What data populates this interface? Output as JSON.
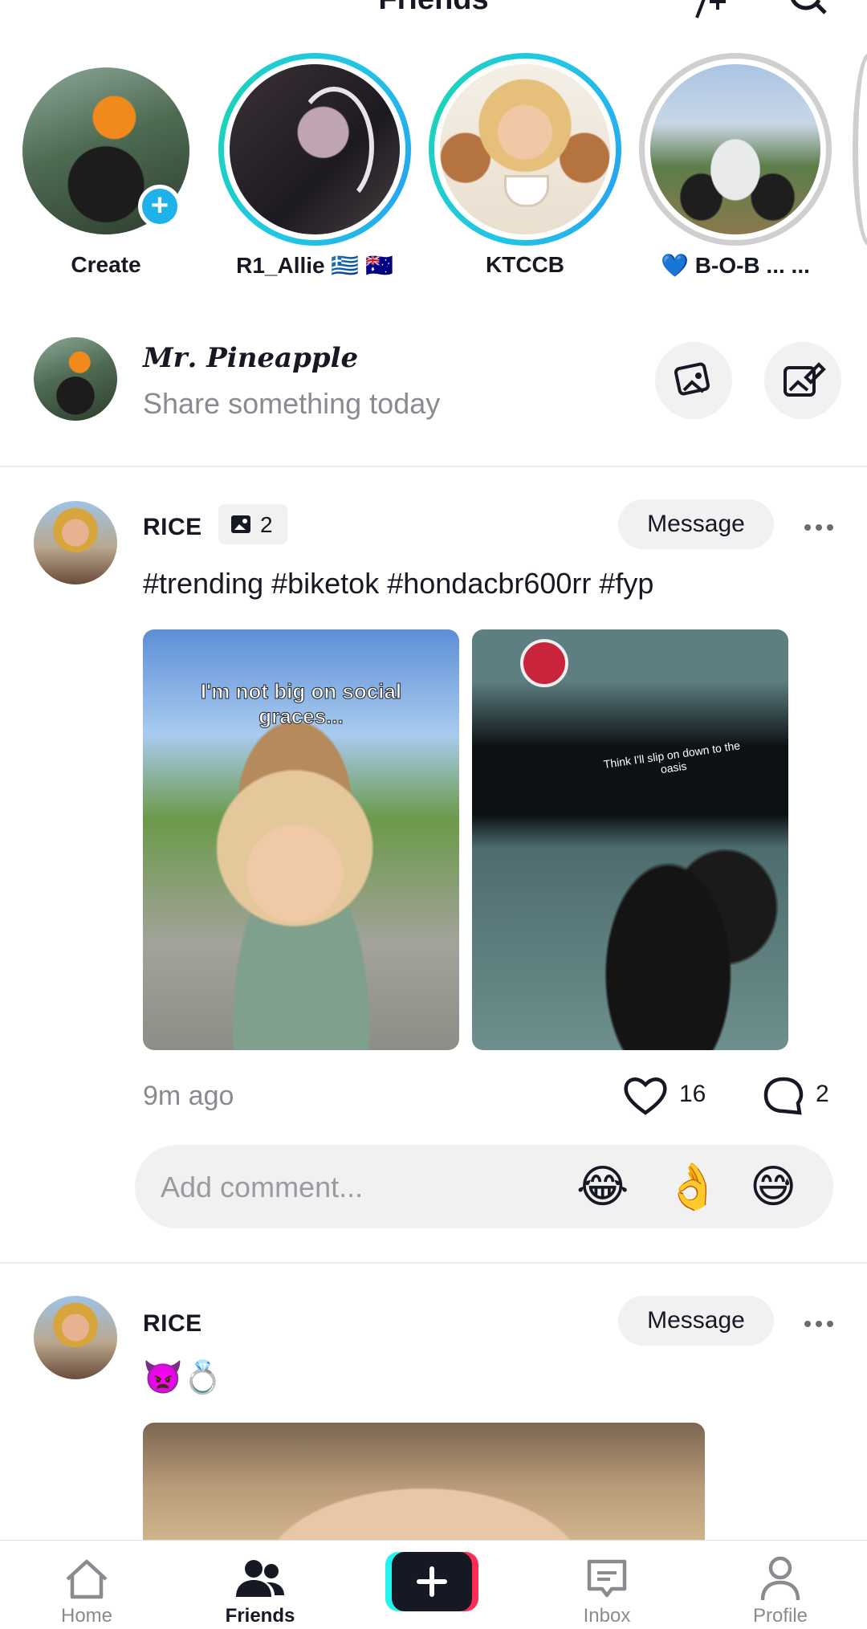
{
  "header": {
    "title": "Friends",
    "add_friend_icon": "person-plus-icon",
    "search_icon": "search-icon"
  },
  "stories": [
    {
      "label": "Create",
      "seen": false,
      "add": true
    },
    {
      "label": "R1_Allie 🇬🇷 🇦🇺",
      "seen": false
    },
    {
      "label": "KTCCB",
      "seen": false
    },
    {
      "label": "💙 B-O-B ... ...",
      "seen": true
    }
  ],
  "composer": {
    "name": "𝑴𝒓. 𝑷𝒊𝒏𝒆𝒂𝒑𝒑𝒍𝒆",
    "placeholder": "Share something today",
    "photo_icon": "photo-icon",
    "edit_icon": "edit-photo-icon"
  },
  "posts": [
    {
      "username": "RICE",
      "photo_count": "2",
      "message_label": "Message",
      "caption": "#trending #biketok #hondacbr600rr #fyp",
      "tiles": [
        {
          "overlay": "I'm not big on social graces..."
        },
        {
          "overlay": "Think I'll slip on down to the oasis"
        }
      ],
      "time": "9m ago",
      "likes": "16",
      "comments": "2",
      "comment_placeholder": "Add comment...",
      "quick_emojis": [
        "😂",
        "👌",
        "😅"
      ]
    },
    {
      "username": "RICE",
      "message_label": "Message",
      "caption": "👿💍"
    }
  ],
  "nav": {
    "items": [
      {
        "label": "Home",
        "icon": "home-icon",
        "active": false
      },
      {
        "label": "Friends",
        "icon": "friends-icon",
        "active": true
      },
      {
        "label": "",
        "icon": "plus-icon",
        "active": false
      },
      {
        "label": "Inbox",
        "icon": "inbox-icon",
        "active": false
      },
      {
        "label": "Profile",
        "icon": "profile-icon",
        "active": false
      }
    ]
  },
  "colors": {
    "accent_blue": "#1fb2ea",
    "ring_teal": "#22c6e6",
    "tiktok_red": "#fe2c55",
    "tiktok_cyan": "#25f4ee"
  }
}
